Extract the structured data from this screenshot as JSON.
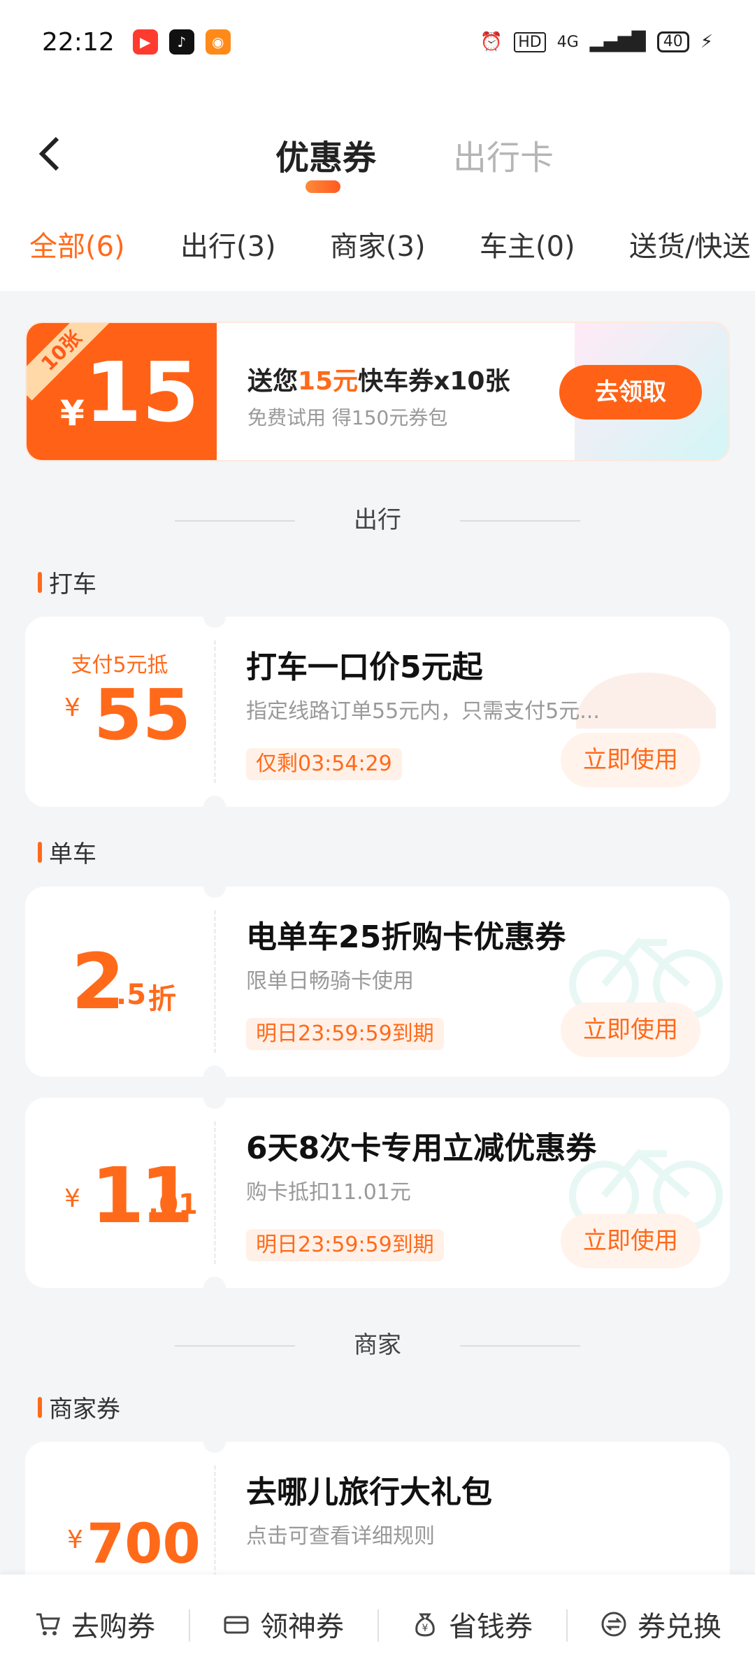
{
  "status_bar": {
    "time": "22:12",
    "battery": "40",
    "network": "4G",
    "hd": "HD"
  },
  "header": {
    "back_label": "‹",
    "tabs": [
      {
        "label": "优惠券",
        "active": true
      },
      {
        "label": "出行卡",
        "active": false
      }
    ]
  },
  "categories": [
    {
      "label": "全部(6)",
      "active": true
    },
    {
      "label": "出行(3)",
      "active": false
    },
    {
      "label": "商家(3)",
      "active": false
    },
    {
      "label": "车主(0)",
      "active": false
    },
    {
      "label": "送货/快送",
      "active": false
    }
  ],
  "promo": {
    "ribbon": "10张",
    "yen": "¥",
    "amount": "15",
    "title_prefix": "送您",
    "title_highlight": "15元",
    "title_suffix": "快车券x10张",
    "subtitle": "免费试用 得150元券包",
    "button": "去领取"
  },
  "sections": {
    "travel": "出行",
    "merchant": "商家"
  },
  "subheads": {
    "taxi": "打车",
    "bike": "单车",
    "merchant_coupon": "商家券"
  },
  "coupons": [
    {
      "top_note": "支付5元抵",
      "yen": "¥",
      "amount": "55",
      "title": "打车一口价5元起",
      "desc": "指定线路订单55元内，只需支付5元...",
      "tag": "仅剩03:54:29",
      "button": "立即使用"
    },
    {
      "amount_main": "2",
      "amount_frac": ".5",
      "unit": "折",
      "title": "电单车25折购卡优惠券",
      "desc": "限单日畅骑卡使用",
      "tag": "明日23:59:59到期",
      "button": "立即使用"
    },
    {
      "yen": "¥",
      "amount_main": "11",
      "amount_frac": ".01",
      "title": "6天8次卡专用立减优惠券",
      "desc": "购卡抵扣11.01元",
      "tag": "明日23:59:59到期",
      "button": "立即使用"
    },
    {
      "yen": "¥",
      "amount": "700",
      "title": "去哪儿旅行大礼包",
      "desc": "点击可查看详细规则"
    }
  ],
  "bottom_nav": [
    {
      "label": "去购券",
      "icon": "cart-icon"
    },
    {
      "label": "领神券",
      "icon": "ticket-icon"
    },
    {
      "label": "省钱券",
      "icon": "money-bag-icon"
    },
    {
      "label": "券兑换",
      "icon": "exchange-icon"
    }
  ],
  "colors": {
    "accent": "#ff6a1a",
    "background": "#f4f5f7"
  }
}
